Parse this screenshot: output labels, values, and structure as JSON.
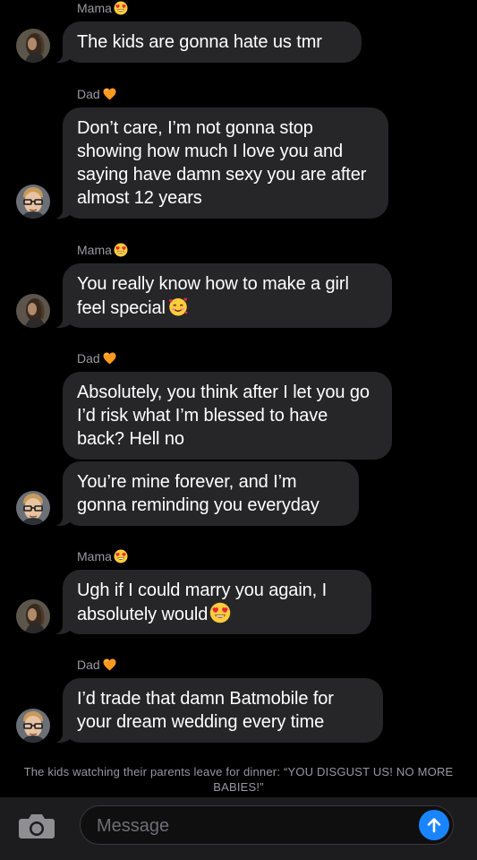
{
  "messages": [
    {
      "sender": "Mama",
      "text": "The kids are gonna hate us tmr",
      "emoji": ""
    },
    {
      "sender": "Dad",
      "text": "Don’t care, I’m not gonna stop showing how much I love you and saying have damn sexy you are after almost 12 years",
      "emoji": ""
    },
    {
      "sender": "Mama",
      "text": "You really know how to make a girl feel special",
      "emoji": "smiling-face-with-hearts"
    },
    {
      "sender": "Dad",
      "text": "Absolutely, you think after I let you go I’d risk what I’m blessed to have back? Hell no",
      "emoji": ""
    },
    {
      "sender": "",
      "text": "You’re mine forever, and I’m gonna reminding you everyday",
      "emoji": ""
    },
    {
      "sender": "Mama",
      "text": "Ugh if I could marry you again, I absolutely would",
      "emoji": "heart-eyes"
    },
    {
      "sender": "Dad",
      "text": "I’d trade that damn Batmobile for your dream wedding every time",
      "emoji": ""
    }
  ],
  "sender_emojis": {
    "Mama": "heart-eyes",
    "Dad": "orange-heart"
  },
  "caption": "The kids watching their parents leave for dinner: “YOU DISGUST US! NO MORE BABIES!”",
  "composer": {
    "placeholder": "Message",
    "value": ""
  },
  "icons": {
    "camera": "camera-icon",
    "send": "arrow-up-icon"
  },
  "colors": {
    "bubble": "#262629",
    "send_button": "#1a84ff",
    "background": "#000000"
  }
}
